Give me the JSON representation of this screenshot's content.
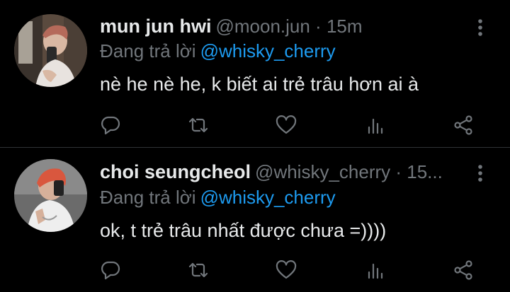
{
  "tweets": [
    {
      "name": "mun jun hwi",
      "handle_time": "@moon.jun · 15m",
      "replying_prefix": "Đang trả lời",
      "replying_to": "@whisky_cherry",
      "text": "nè he nè he, k biết ai trẻ trâu hơn ai à"
    },
    {
      "name": "choi seungcheol",
      "handle_time": "@whisky_cherry · 15...",
      "replying_prefix": "Đang trả lời",
      "replying_to": "@whisky_cherry",
      "text": "ok, t trẻ trâu nhất được chưa =))))"
    }
  ],
  "icons": {
    "reply": "reply-icon",
    "retweet": "retweet-icon",
    "like": "like-icon",
    "stats": "stats-icon",
    "share": "share-icon",
    "more": "more-vertical-icon"
  },
  "colors": {
    "background": "#000000",
    "text": "#e7e9ea",
    "secondary": "#71767b",
    "mention": "#1d9bf0",
    "divider": "#2f3336"
  }
}
